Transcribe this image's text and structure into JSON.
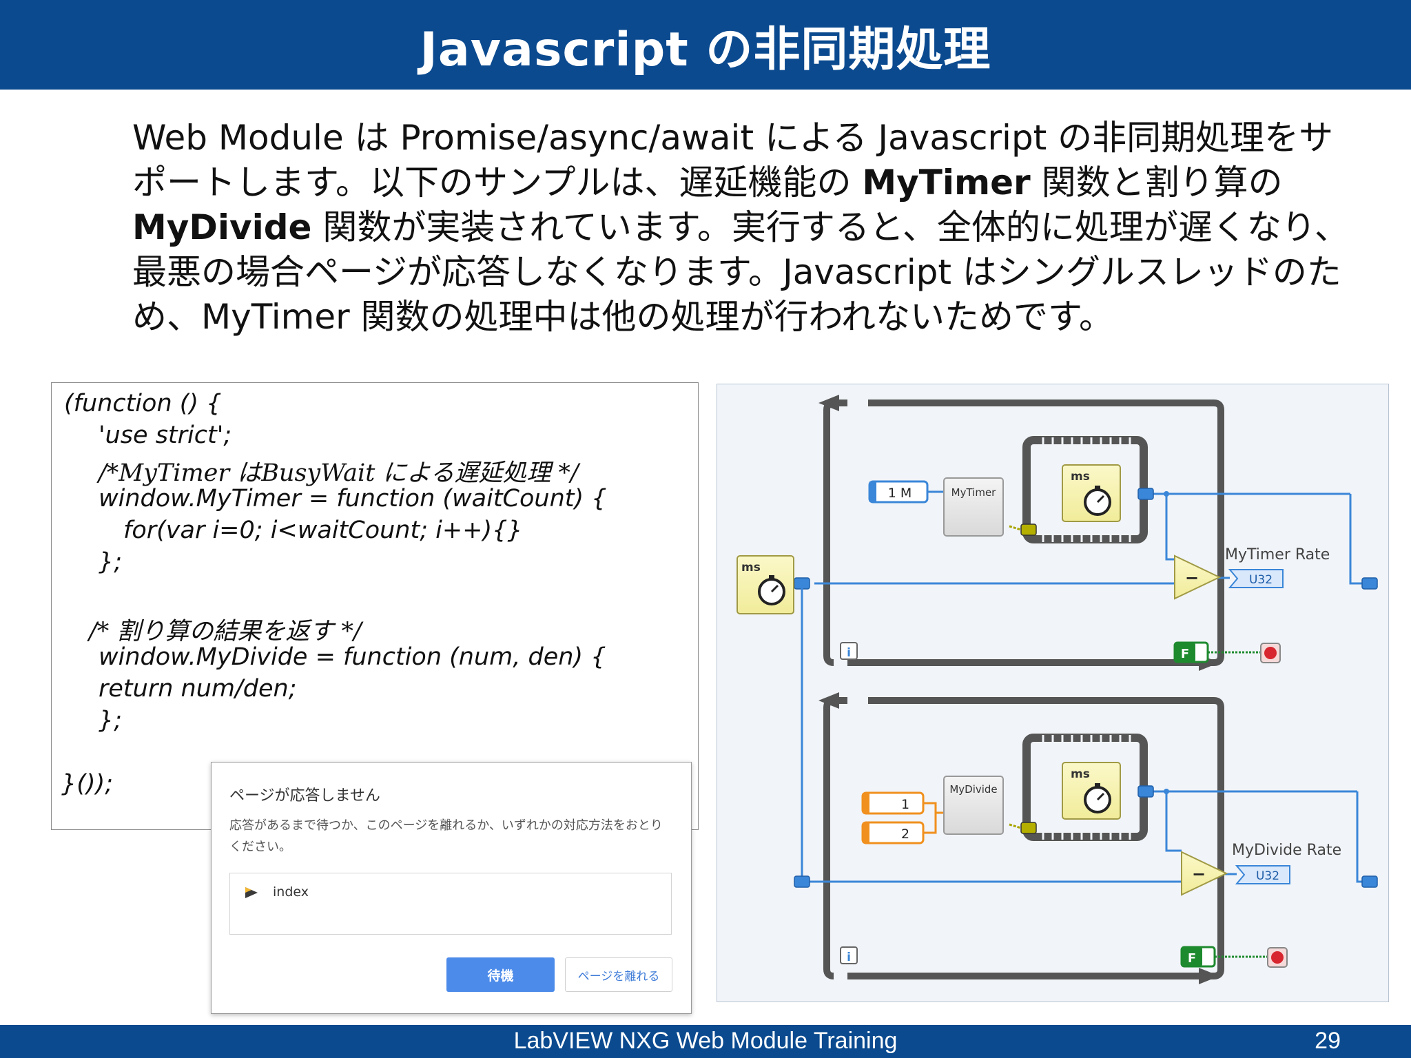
{
  "header": {
    "title": "Javascript の非同期処理"
  },
  "intro": {
    "p1": "Web Module は Promise/async/await による Javascript の非同期処理をサポートします。以下のサンプルは、遅延機能の ",
    "b1": "MyTimer",
    "p2": " 関数と割り算の ",
    "b2": "MyDivide",
    "p3": " 関数が実装されています。実行すると、全体的に処理が遅くなり、最悪の場合ページが応答しなくなります。Javascript はシングルスレッドのため、MyTimer 関数の処理中は他の処理が行われないためです。"
  },
  "code": {
    "lines": [
      "(function () {",
      "'use strict';",
      "/*MyTimer はBusyWait による遅延処理 */",
      "window.MyTimer = function (waitCount) {",
      "for(var i=0; i<waitCount; i++){}",
      "};",
      "/* 割り算の結果を返す */",
      "window.MyDivide = function (num, den) {",
      "return num/den;",
      "};",
      "}());"
    ]
  },
  "dialog": {
    "title": "ページが応答しません",
    "message": "応答があるまで待つか、このページを離れるか、いずれかの対応方法をおとりください。",
    "item_label": "index",
    "wait_button": "待機",
    "leave_button": "ページを離れる"
  },
  "diagram": {
    "loop1": {
      "constant": "1 M",
      "function_name": "MyTimer",
      "timer_label": "ms",
      "subtract_symbol": "−",
      "indicator_label": "MyTimer Rate",
      "indicator_type": "U32",
      "stop_constant": "F",
      "info_icon": "i"
    },
    "loop2": {
      "constant_a": "1",
      "constant_b": "2",
      "function_name": "MyDivide",
      "timer_label": "ms",
      "subtract_symbol": "−",
      "indicator_label": "MyDivide Rate",
      "indicator_type": "U32",
      "stop_constant": "F",
      "info_icon": "i"
    },
    "outer_timer_label": "ms",
    "colors": {
      "wire_blue": "#3a86d8",
      "wire_yellow": "#a8a400",
      "orange": "#f0901e",
      "green": "#1d8a2e",
      "loop_gray": "#555555"
    }
  },
  "footer": {
    "title": "LabVIEW NXG Web Module Training",
    "page": "29"
  }
}
